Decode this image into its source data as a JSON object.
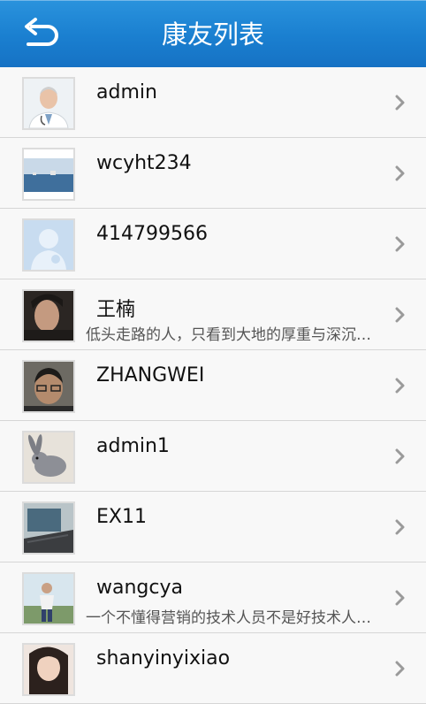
{
  "header": {
    "title": "康友列表",
    "back_icon": "back-arrow-icon"
  },
  "friends": [
    {
      "name": "admin",
      "signature": "",
      "avatar": "doctor-photo"
    },
    {
      "name": "wcyht234",
      "signature": "",
      "avatar": "sea-photo"
    },
    {
      "name": "414799566",
      "signature": "",
      "avatar": "default-avatar"
    },
    {
      "name": "王楠",
      "signature": "低头走路的人，只看到大地的厚重与深沉…",
      "avatar": "boy-photo"
    },
    {
      "name": "ZHANGWEI",
      "signature": "",
      "avatar": "man-photo"
    },
    {
      "name": "admin1",
      "signature": "",
      "avatar": "rabbit-photo"
    },
    {
      "name": "EX11",
      "signature": "",
      "avatar": "laptop-photo"
    },
    {
      "name": "wangcya",
      "signature": "一个不懂得营销的技术人员不是好技术人…",
      "avatar": "person-outdoor-photo"
    },
    {
      "name": "shanyinyixiao",
      "signature": "",
      "avatar": "woman-photo"
    }
  ],
  "colors": {
    "header_blue": "#1a7fd0",
    "row_background": "#f8f8f8",
    "chevron_gray": "#9a9a9a"
  }
}
